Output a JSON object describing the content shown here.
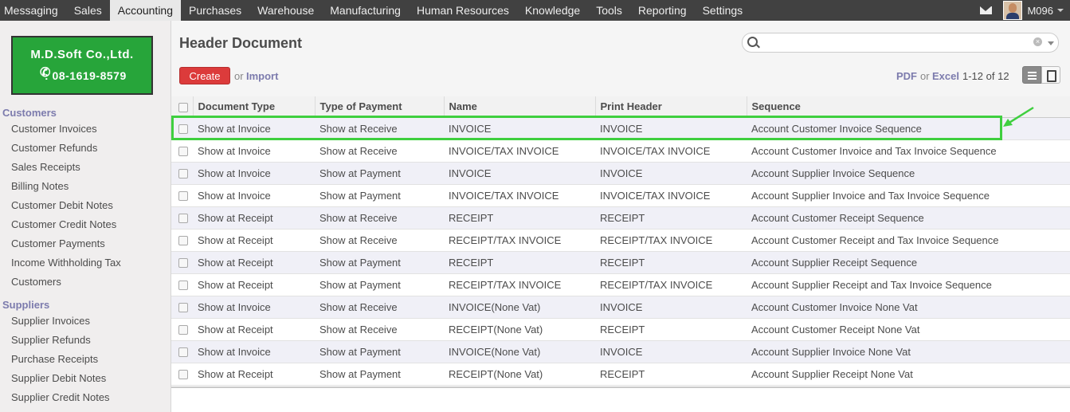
{
  "topnav": {
    "items": [
      "Messaging",
      "Sales",
      "Accounting",
      "Purchases",
      "Warehouse",
      "Manufacturing",
      "Human Resources",
      "Knowledge",
      "Tools",
      "Reporting",
      "Settings"
    ],
    "active": "Accounting",
    "user": "M096",
    "icons": [
      "mail-icon",
      "avatar",
      "chevron-down-icon"
    ]
  },
  "logo": {
    "company": "M.D.Soft Co.,Ltd.",
    "phone": ": 08-1619-8579",
    "brand_color": "#27a53a"
  },
  "sidebar": {
    "sections": [
      {
        "title": "Customers",
        "items": [
          "Customer Invoices",
          "Customer Refunds",
          "Sales Receipts",
          "Billing Notes",
          "Customer Debit Notes",
          "Customer Credit Notes",
          "Customer Payments",
          "Income Withholding Tax",
          "Customers"
        ]
      },
      {
        "title": "Suppliers",
        "items": [
          "Supplier Invoices",
          "Supplier Refunds",
          "Purchase Receipts",
          "Supplier Debit Notes",
          "Supplier Credit Notes"
        ]
      }
    ]
  },
  "header": {
    "title": "Header Document",
    "search_placeholder": "",
    "create_label": "Create",
    "or_label": "or",
    "import_label": "Import",
    "pdf_label": "PDF",
    "excel_label": "Excel",
    "pager": "1-12 of 12"
  },
  "table": {
    "columns": [
      "Document Type",
      "Type of Payment",
      "Name",
      "Print Header",
      "Sequence"
    ],
    "rows": [
      [
        "Show at Invoice",
        "Show at Receive",
        "INVOICE",
        "INVOICE",
        "Account Customer Invoice Sequence"
      ],
      [
        "Show at Invoice",
        "Show at Receive",
        "INVOICE/TAX INVOICE",
        "INVOICE/TAX INVOICE",
        "Account Customer Invoice and Tax Invoice Sequence"
      ],
      [
        "Show at Invoice",
        "Show at Payment",
        "INVOICE",
        "INVOICE",
        "Account Supplier Invoice Sequence"
      ],
      [
        "Show at Invoice",
        "Show at Payment",
        "INVOICE/TAX INVOICE",
        "INVOICE/TAX INVOICE",
        "Account Supplier Invoice and Tax Invoice Sequence"
      ],
      [
        "Show at Receipt",
        "Show at Receive",
        "RECEIPT",
        "RECEIPT",
        "Account Customer Receipt Sequence"
      ],
      [
        "Show at Receipt",
        "Show at Receive",
        "RECEIPT/TAX INVOICE",
        "RECEIPT/TAX INVOICE",
        "Account Customer Receipt and Tax Invoice Sequence"
      ],
      [
        "Show at Receipt",
        "Show at Payment",
        "RECEIPT",
        "RECEIPT",
        "Account Supplier Receipt Sequence"
      ],
      [
        "Show at Receipt",
        "Show at Payment",
        "RECEIPT/TAX INVOICE",
        "RECEIPT/TAX INVOICE",
        "Account Supplier Receipt and Tax Invoice Sequence"
      ],
      [
        "Show at Invoice",
        "Show at Receive",
        "INVOICE(None Vat)",
        "INVOICE",
        "Account Customer Invoice None Vat"
      ],
      [
        "Show at Receipt",
        "Show at Receive",
        "RECEIPT(None Vat)",
        "RECEIPT",
        "Account Customer Receipt None Vat"
      ],
      [
        "Show at Invoice",
        "Show at Payment",
        "INVOICE(None Vat)",
        "INVOICE",
        "Account Supplier Invoice None Vat"
      ],
      [
        "Show at Receipt",
        "Show at Payment",
        "RECEIPT(None Vat)",
        "RECEIPT",
        "Account Supplier Receipt None Vat"
      ]
    ],
    "highlighted_row": 0,
    "highlight_color": "#3fcf3f"
  }
}
